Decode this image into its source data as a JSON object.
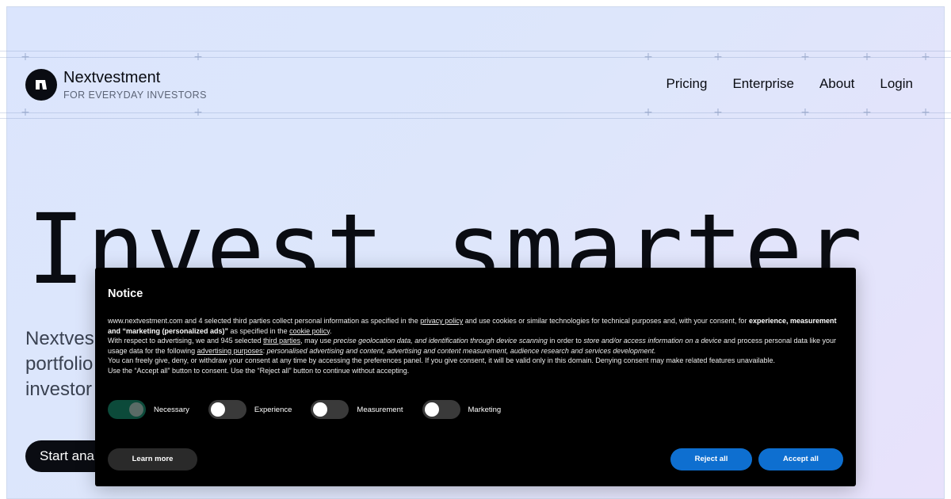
{
  "header": {
    "brand_name": "Nextvestment",
    "brand_tagline": "FOR EVERYDAY INVESTORS",
    "nav": [
      {
        "label": "Pricing"
      },
      {
        "label": "Enterprise"
      },
      {
        "label": "About"
      },
      {
        "label": "Login"
      }
    ]
  },
  "hero": {
    "title": "Invest smarter",
    "subtitle_lines": [
      "Nextves",
      "portfolio",
      "investor"
    ],
    "cta_label": "Start anal"
  },
  "notice": {
    "title": "Notice",
    "paragraph1": {
      "a": "www.nextvestment.com and 4 selected third parties collect personal information as specified in the ",
      "link1": "privacy policy",
      "b": " and use cookies or similar technologies for technical purposes and, with your consent, for ",
      "bold1": "experience, measurement and “marketing (personalized ads)”",
      "c": " as specified in the ",
      "link2": "cookie policy",
      "d": "."
    },
    "paragraph2": {
      "a": "With respect to advertising, we and 945 selected ",
      "link1": "third parties",
      "b": ", may use ",
      "italic1": "precise geolocation data, and identification through device scanning",
      "c": " in order to ",
      "italic2": "store and/or access information on a device",
      "d": " and process personal data like your usage data for the following ",
      "link2": "advertising purposes",
      "e": ": ",
      "italic3": "personalised advertising and content, advertising and content measurement, audience research and services development."
    },
    "paragraph3": "You can freely give, deny, or withdraw your consent at any time by accessing the preferences panel. If you give consent, it will be valid only in this domain. Denying consent may make related features unavailable.",
    "paragraph4": "Use the “Accept all” button to consent. Use the “Reject all” button to continue without accepting.",
    "toggles": [
      {
        "label": "Necessary",
        "on": true
      },
      {
        "label": "Experience",
        "on": false
      },
      {
        "label": "Measurement",
        "on": false
      },
      {
        "label": "Marketing",
        "on": false
      }
    ],
    "learn_more": "Learn more",
    "reject_all": "Reject all",
    "accept_all": "Accept all"
  },
  "colors": {
    "brand_dark": "#0a0c12",
    "button_blue": "#0e6fd0",
    "toggle_on": "#0c4a3a"
  }
}
